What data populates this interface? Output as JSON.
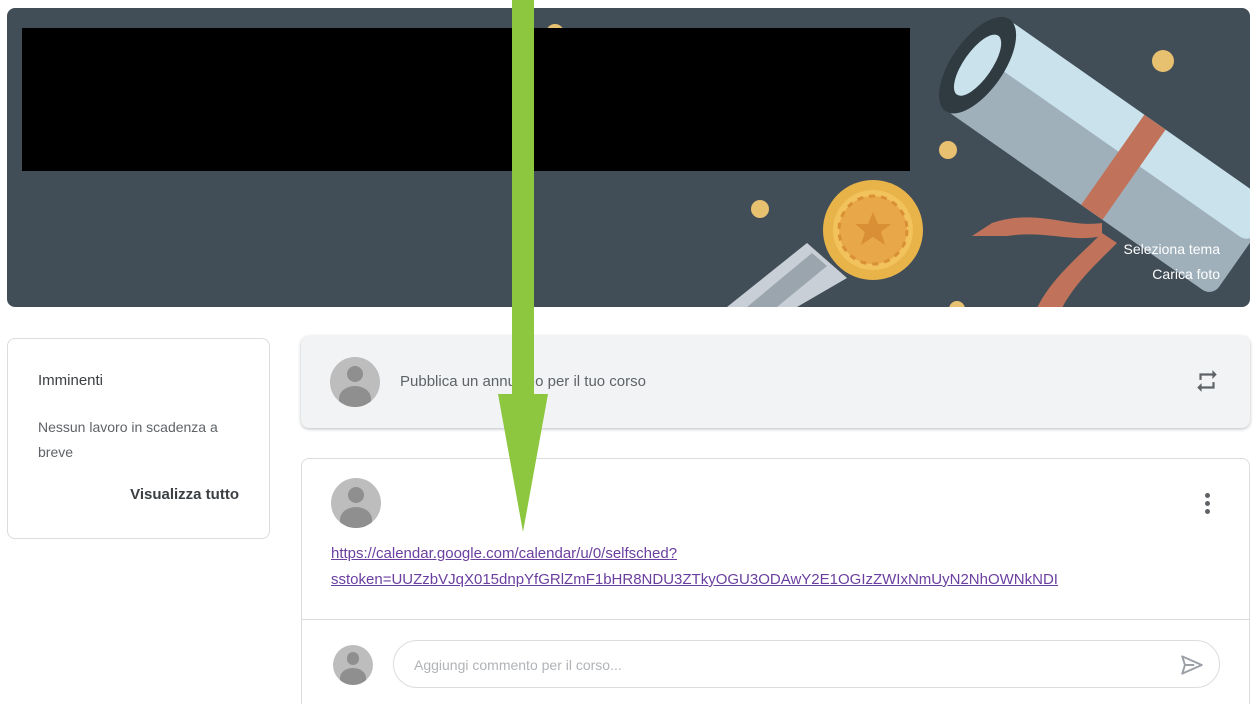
{
  "banner": {
    "theme_link": "Seleziona tema",
    "upload_link": "Carica foto",
    "background_color": "#424e57"
  },
  "upcoming": {
    "title": "Imminenti",
    "empty_message": "Nessun lavoro in scadenza a breve",
    "view_all": "Visualizza tutto"
  },
  "composer": {
    "placeholder": "Pubblica un annuncio per il tuo corso",
    "icon": "repost-icon"
  },
  "post": {
    "link_line1": "https://calendar.google.com/calendar/u/0/selfsched?",
    "link_line2": "sstoken=UUZzbVJqX015dnpYfGRlZmF1bHR8NDU3ZTkyOGU3ODAwY2E1OGIzZWIxNmUyN2NhOWNkNDI",
    "link_color": "#6b3fa0",
    "menu_icon": "more-vert-icon"
  },
  "comment": {
    "placeholder": "Aggiungi commento per il corso...",
    "send_icon": "send-icon"
  },
  "annotation": {
    "arrow_color": "#8dc63f"
  }
}
